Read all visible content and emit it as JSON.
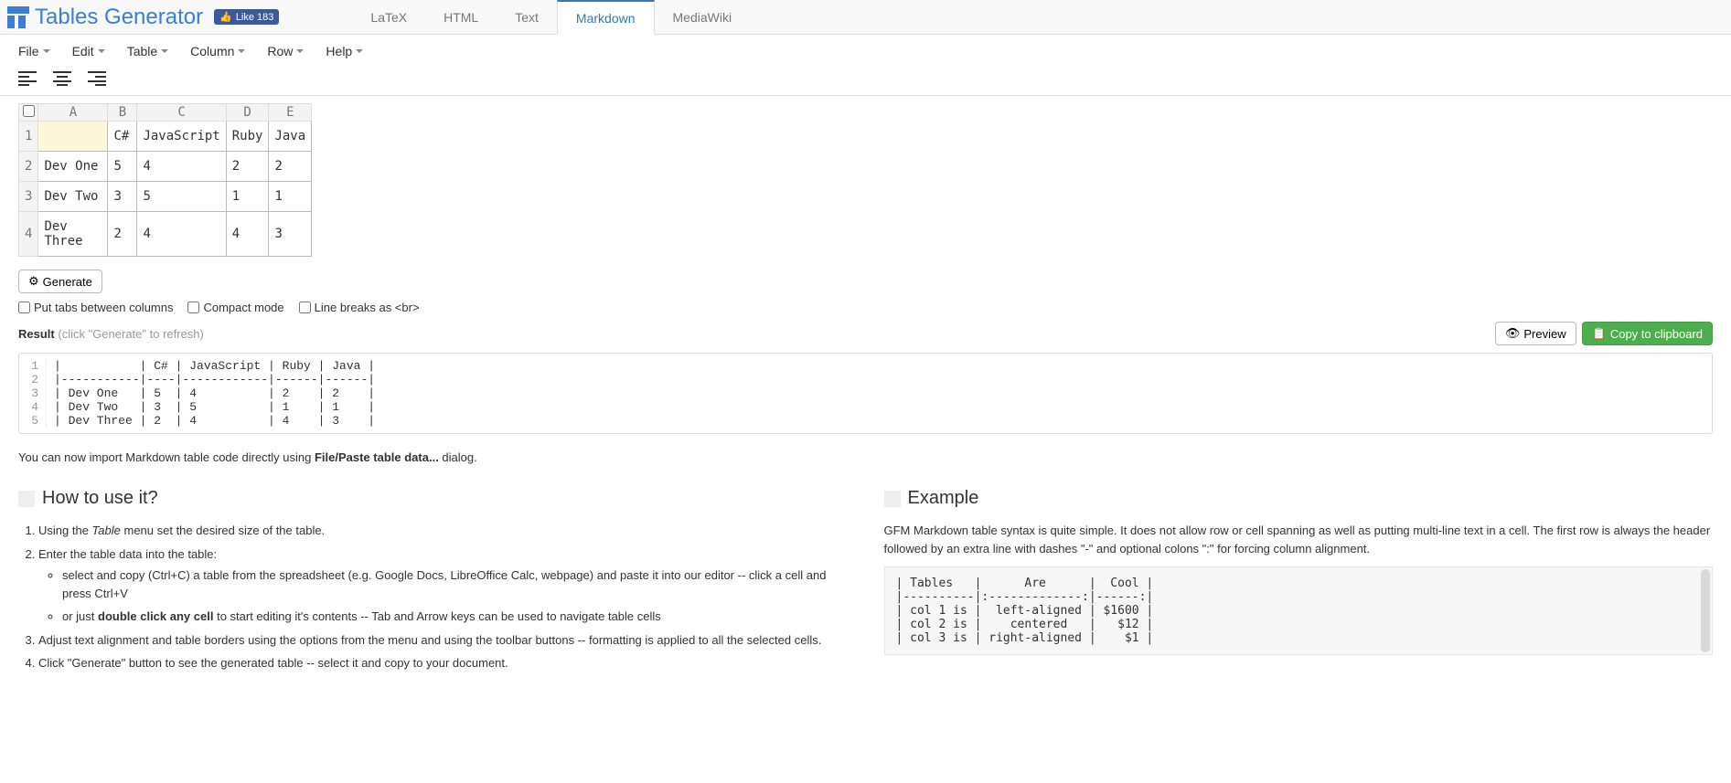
{
  "brand": "Tables Generator",
  "fb_like": "Like 183",
  "nav_tabs": [
    "LaTeX",
    "HTML",
    "Text",
    "Markdown",
    "MediaWiki"
  ],
  "active_tab": "Markdown",
  "menus": [
    "File",
    "Edit",
    "Table",
    "Column",
    "Row",
    "Help"
  ],
  "sheet": {
    "col_headers": [
      "A",
      "B",
      "C",
      "D",
      "E"
    ],
    "row_headers": [
      "1",
      "2",
      "3",
      "4"
    ],
    "rows": [
      [
        "",
        "C#",
        "JavaScript",
        "Ruby",
        "Java"
      ],
      [
        "Dev One",
        "5",
        "4",
        "2",
        "2"
      ],
      [
        "Dev Two",
        "3",
        "5",
        "1",
        "1"
      ],
      [
        "Dev Three",
        "2",
        "4",
        "4",
        "3"
      ]
    ],
    "selected": [
      0,
      0
    ]
  },
  "generate_label": "Generate",
  "options": {
    "tabs": "Put tabs between columns",
    "compact": "Compact mode",
    "br": "Line breaks as <br>"
  },
  "result": {
    "label": "Result",
    "hint": "(click \"Generate\" to refresh)"
  },
  "preview_label": "Preview",
  "copy_label": "Copy to clipboard",
  "code_lines": [
    "|           | C# | JavaScript | Ruby | Java |",
    "|-----------|----|------------|------|------|",
    "| Dev One   | 5  | 4          | 2    | 2    |",
    "| Dev Two   | 3  | 5          | 1    | 1    |",
    "| Dev Three | 2  | 4          | 4    | 3    |"
  ],
  "import_note": {
    "pre": "You can now import Markdown table code directly using ",
    "strong": "File/Paste table data...",
    "post": " dialog."
  },
  "howto": {
    "title": "How to use it?",
    "steps": {
      "s1a": "Using the ",
      "s1i": "Table",
      "s1b": " menu set the desired size of the table.",
      "s2": "Enter the table data into the table:",
      "s2a": "select and copy (Ctrl+C) a table from the spreadsheet (e.g. Google Docs, LibreOffice Calc, webpage) and paste it into our editor -- click a cell and press Ctrl+V",
      "s2b_pre": "or just ",
      "s2b_strong": "double click any cell",
      "s2b_post": " to start editing it's contents -- Tab and Arrow keys can be used to navigate table cells",
      "s3": "Adjust text alignment and table borders using the options from the menu and using the toolbar buttons -- formatting is applied to all the selected cells.",
      "s4": "Click \"Generate\" button to see the generated table -- select it and copy to your document."
    }
  },
  "example": {
    "title": "Example",
    "desc": "GFM Markdown table syntax is quite simple. It does not allow row or cell spanning as well as putting multi-line text in a cell. The first row is always the header followed by an extra line with dashes \"-\" and optional colons \":\" for forcing column alignment.",
    "code": "| Tables   |      Are      |  Cool |\n|----------|:-------------:|------:|\n| col 1 is |  left-aligned | $1600 |\n| col 2 is |    centered   |   $12 |\n| col 3 is | right-aligned |    $1 |"
  }
}
